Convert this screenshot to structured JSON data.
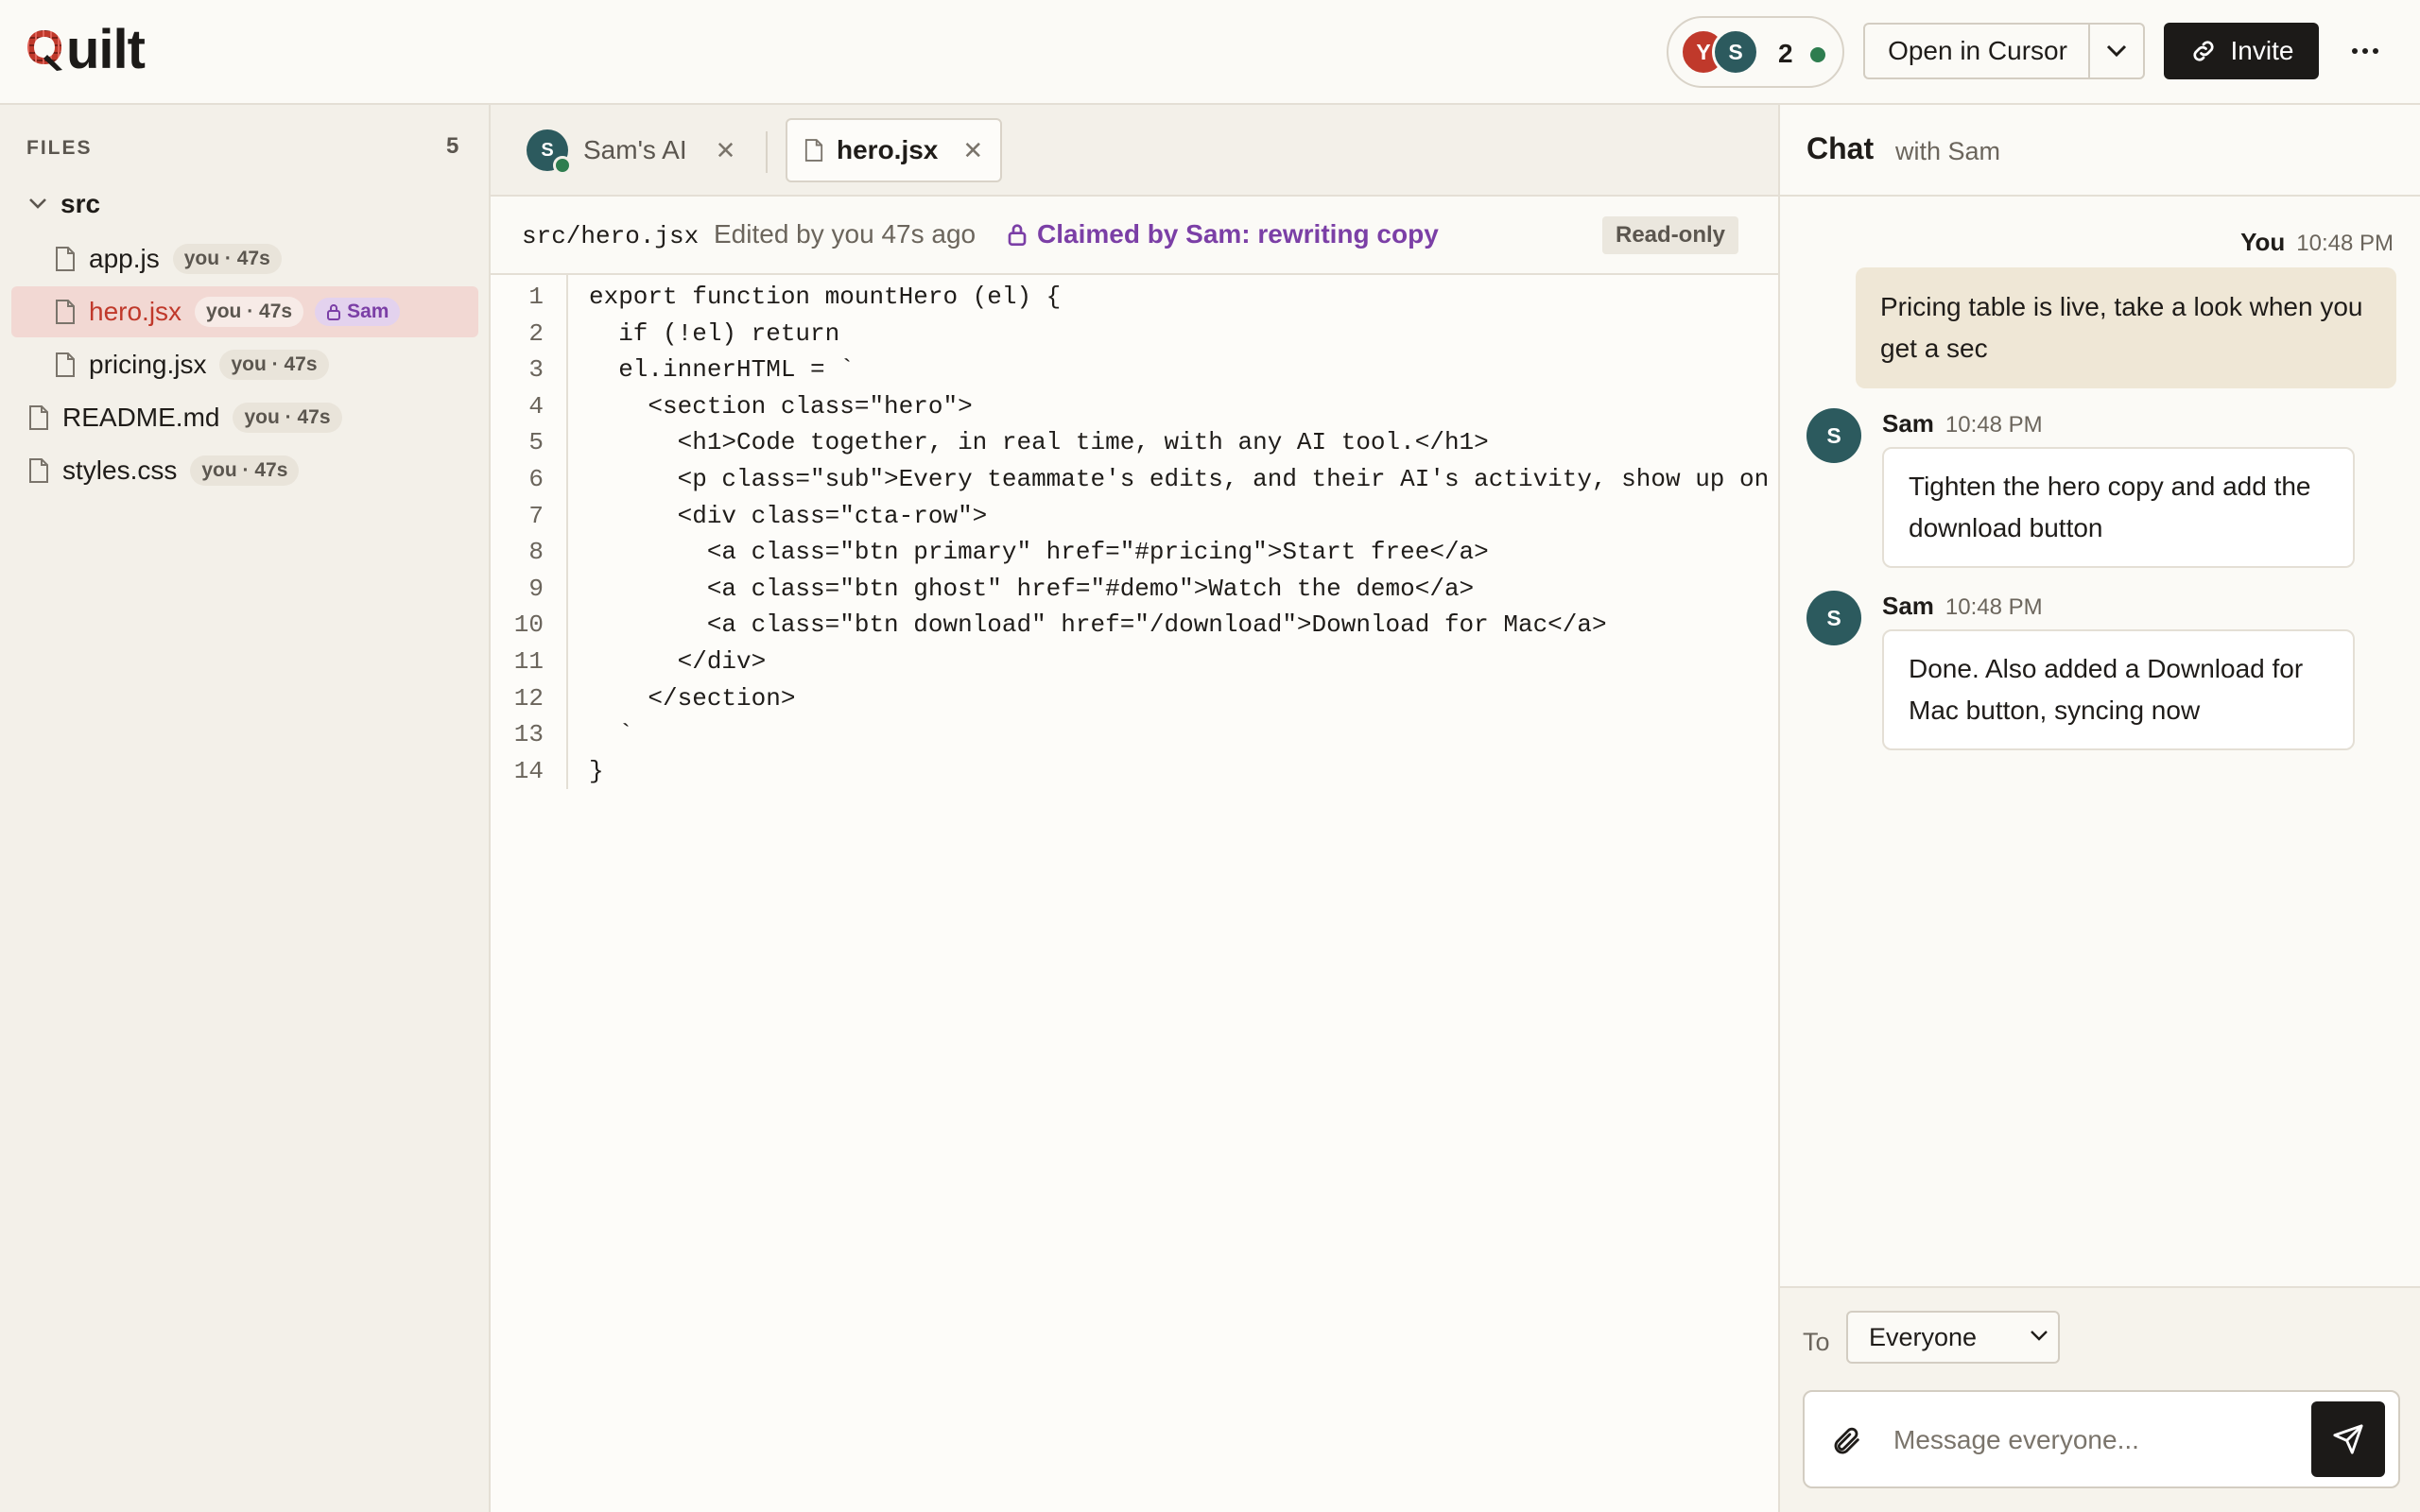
{
  "app": {
    "name_rest": "uilt",
    "brand_color": "#c0392b"
  },
  "presence": {
    "avatars": [
      {
        "initial": "Y",
        "color": "#c0392b"
      },
      {
        "initial": "S",
        "color": "#2c5a5e"
      }
    ],
    "count": "2",
    "status_color": "#2e7d4f"
  },
  "toolbar": {
    "open_label": "Open in Cursor",
    "invite_label": "Invite",
    "more_icon": "more-horizontal-icon"
  },
  "sidebar": {
    "heading": "FILES",
    "count": "5",
    "folder": "src",
    "files": [
      {
        "name": "app.js",
        "tag": "you · 47s"
      },
      {
        "name": "hero.jsx",
        "tag": "you · 47s",
        "lock_tag": "Sam",
        "active": true
      },
      {
        "name": "pricing.jsx",
        "tag": "you · 47s"
      },
      {
        "name": "README.md",
        "tag": "you · 47s"
      },
      {
        "name": "styles.css",
        "tag": "you · 47s"
      }
    ]
  },
  "tabs": [
    {
      "label": "Sam's AI",
      "avatar": "S"
    },
    {
      "label": "hero.jsx"
    }
  ],
  "file_info": {
    "path": "src/hero.jsx",
    "edited": "Edited by you 47s ago",
    "claimed": "Claimed by Sam: rewriting copy",
    "mode": "Read-only"
  },
  "code_lines": [
    "export function mountHero (el) {",
    "  if (!el) return",
    "  el.innerHTML = `",
    "    <section class=\"hero\">",
    "      <h1>Code together, in real time, with any AI tool.</h1>",
    "      <p class=\"sub\">Every teammate's edits, and their AI's activity, show up on you",
    "      <div class=\"cta-row\">",
    "        <a class=\"btn primary\" href=\"#pricing\">Start free</a>",
    "        <a class=\"btn ghost\" href=\"#demo\">Watch the demo</a>",
    "        <a class=\"btn download\" href=\"/download\">Download for Mac</a>",
    "      </div>",
    "    </section>",
    "  `",
    "}"
  ],
  "chat": {
    "title": "Chat",
    "subtitle": "with Sam",
    "messages": [
      {
        "author": "You",
        "time": "10:48 PM",
        "text": "Pricing table is live, take a look when you get a sec"
      },
      {
        "author": "Sam",
        "initial": "S",
        "time": "10:48 PM",
        "text": "Tighten the hero copy and add the download button"
      },
      {
        "author": "Sam",
        "initial": "S",
        "time": "10:48 PM",
        "text": "Done. Also added a Download for Mac button, syncing now"
      }
    ],
    "to_label": "To",
    "recipient": "Everyone",
    "placeholder": "Message everyone..."
  }
}
